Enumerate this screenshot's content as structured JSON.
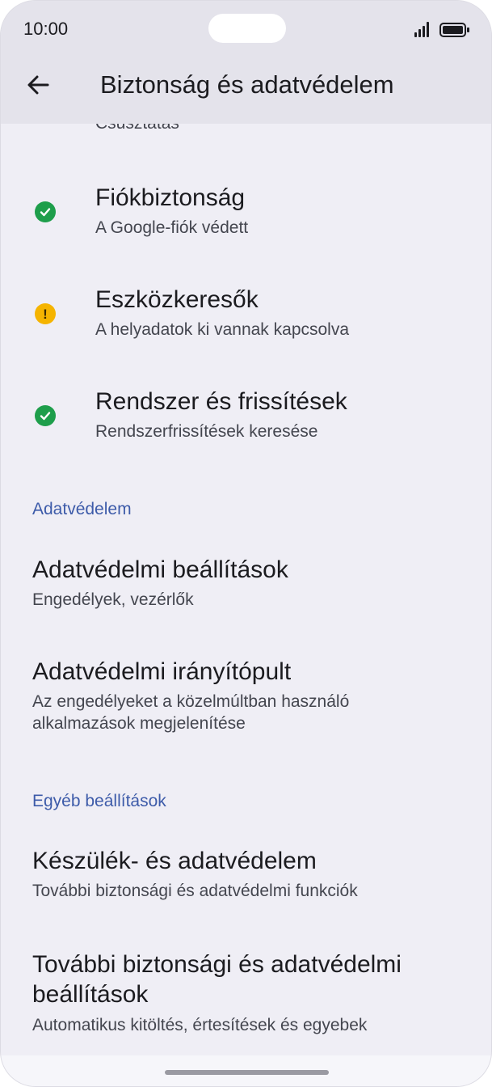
{
  "status_bar": {
    "time": "10:00"
  },
  "app_bar": {
    "title": "Biztonság és adatvédelem"
  },
  "clipped_item": {
    "subtitle": "Csúsztatás"
  },
  "security_items": [
    {
      "title": "Fiókbiztonság",
      "subtitle": "A Google-fiók védett",
      "status": "ok"
    },
    {
      "title": "Eszközkeresők",
      "subtitle": "A helyadatok ki vannak kapcsolva",
      "status": "warning"
    },
    {
      "title": "Rendszer és frissítések",
      "subtitle": "Rendszerfrissítések keresése",
      "status": "ok"
    }
  ],
  "privacy_section": {
    "header": "Adatvédelem",
    "items": [
      {
        "title": "Adatvédelmi beállítások",
        "subtitle": "Engedélyek, vezérlők"
      },
      {
        "title": "Adatvédelmi irányítópult",
        "subtitle_line1": "Az engedélyeket a közelmúltban használó",
        "subtitle_line2": "alkalmazások megjelenítése"
      }
    ]
  },
  "other_section": {
    "header": "Egyéb beállítások",
    "items": [
      {
        "title": "Készülék- és adatvédelem",
        "subtitle": "További biztonsági és adatvédelmi funkciók"
      },
      {
        "title_line1": "További biztonsági és adatvédelmi",
        "title_line2": "beállítások",
        "subtitle": "Automatikus kitöltés, értesítések és egyebek"
      }
    ]
  },
  "colors": {
    "ok": "#1e9e4b",
    "warning": "#f5b400",
    "section": "#3d5ba9",
    "bar": "#e4e3eb",
    "background": "#efeef5"
  }
}
